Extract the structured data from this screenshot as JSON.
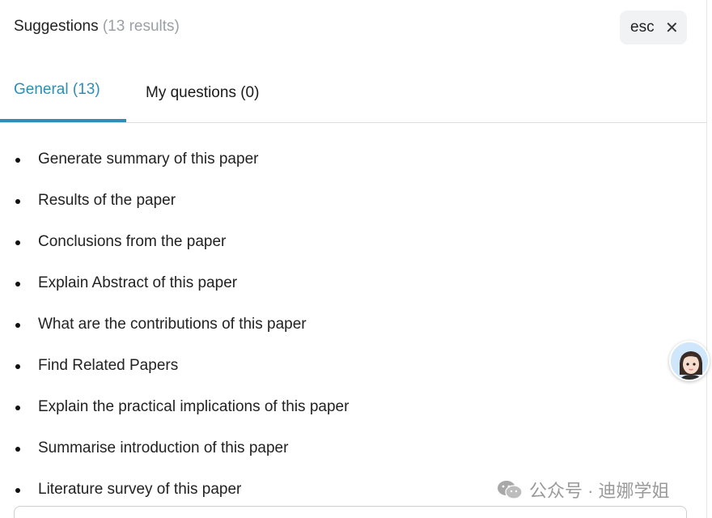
{
  "header": {
    "title": "Suggestions",
    "count": "(13 results)"
  },
  "close_button": {
    "label": "esc",
    "icon": "close-icon"
  },
  "tabs": [
    {
      "label": "General (13)",
      "active": true
    },
    {
      "label": "My questions (0)",
      "active": false
    }
  ],
  "suggestions": [
    "Generate summary of this paper",
    "Results of the paper",
    "Conclusions from the paper",
    "Explain Abstract of this paper",
    "What are the contributions of this paper",
    "Find Related Papers",
    "Explain the practical implications of this paper",
    "Summarise introduction of this paper",
    "Literature survey of this paper"
  ],
  "watermark": {
    "text": "公众号 · 迪娜学姐",
    "icon": "wechat-icon"
  },
  "colors": {
    "accent": "#2d8fb4",
    "muted": "#9aa0a6",
    "esc_bg": "#f1f2f4"
  }
}
